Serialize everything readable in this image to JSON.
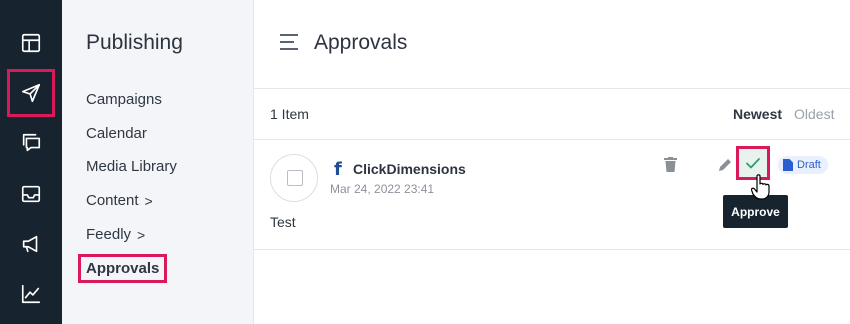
{
  "rail": {
    "items": [
      {
        "icon": "layout-icon"
      },
      {
        "icon": "send-icon",
        "highlighted": true
      },
      {
        "icon": "chat-icon"
      },
      {
        "icon": "inbox-icon"
      },
      {
        "icon": "megaphone-icon"
      },
      {
        "icon": "chart-icon"
      }
    ]
  },
  "sidebar": {
    "title": "Publishing",
    "items": [
      {
        "label": "Campaigns"
      },
      {
        "label": "Calendar"
      },
      {
        "label": "Media Library"
      },
      {
        "label": "Content",
        "chevron": ">"
      },
      {
        "label": "Feedly",
        "chevron": ">"
      },
      {
        "label": "Approvals",
        "active": true
      }
    ]
  },
  "header": {
    "title": "Approvals"
  },
  "list": {
    "count": "1 Item",
    "sort_newest": "Newest",
    "sort_oldest": "Oldest"
  },
  "post": {
    "network_icon": "f",
    "account": "ClickDimensions",
    "date": "Mar 24, 2022 23:41",
    "text": "Test",
    "status": "Draft",
    "approve_tooltip": "Approve"
  },
  "colors": {
    "rail_bg": "#17232e",
    "highlight": "#d9195a",
    "approve_check": "#2e9e6b",
    "draft_text": "#2a5dcd"
  }
}
